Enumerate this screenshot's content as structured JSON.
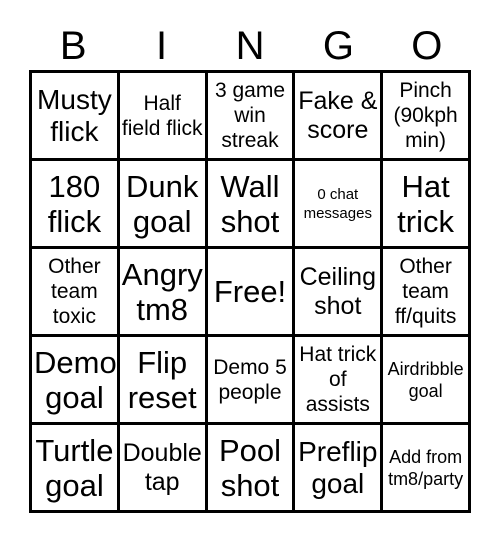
{
  "card": {
    "headers": [
      "B",
      "I",
      "N",
      "G",
      "O"
    ],
    "rows": [
      [
        {
          "text": "Musty flick",
          "size": "xl"
        },
        {
          "text": "Half field flick",
          "size": "md"
        },
        {
          "text": "3 game win streak",
          "size": "md"
        },
        {
          "text": "Fake & score",
          "size": "lg"
        },
        {
          "text": "Pinch (90kph min)",
          "size": "md"
        }
      ],
      [
        {
          "text": "180 flick",
          "size": "xxl"
        },
        {
          "text": "Dunk goal",
          "size": "xxl"
        },
        {
          "text": "Wall shot",
          "size": "xxl"
        },
        {
          "text": "0 chat messages",
          "size": "xs"
        },
        {
          "text": "Hat trick",
          "size": "xxl"
        }
      ],
      [
        {
          "text": "Other team toxic",
          "size": "md"
        },
        {
          "text": "Angry tm8",
          "size": "xxl"
        },
        {
          "text": "Free!",
          "size": "xxl"
        },
        {
          "text": "Ceiling shot",
          "size": "lg"
        },
        {
          "text": "Other team ff/quits",
          "size": "md"
        }
      ],
      [
        {
          "text": "Demo goal",
          "size": "xxl"
        },
        {
          "text": "Flip reset",
          "size": "xxl"
        },
        {
          "text": "Demo 5 people",
          "size": "md"
        },
        {
          "text": "Hat trick of assists",
          "size": "md"
        },
        {
          "text": "Airdribble goal",
          "size": "sm"
        }
      ],
      [
        {
          "text": "Turtle goal",
          "size": "xxl"
        },
        {
          "text": "Double tap",
          "size": "lg"
        },
        {
          "text": "Pool shot",
          "size": "xxl"
        },
        {
          "text": "Preflip goal",
          "size": "xl"
        },
        {
          "text": "Add from tm8/party",
          "size": "sm"
        }
      ]
    ]
  }
}
